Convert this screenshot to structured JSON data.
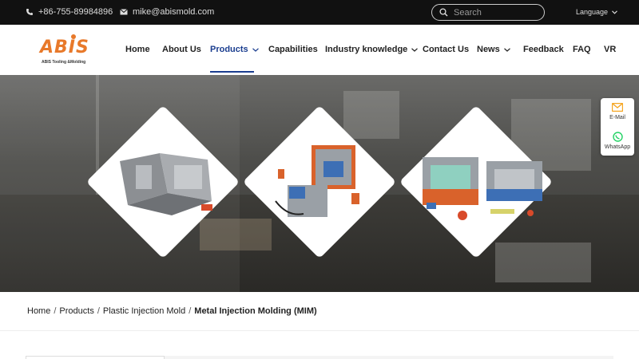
{
  "topbar": {
    "phone": "+86-755-89984896",
    "email": "mike@abismold.com",
    "search_placeholder": "Search",
    "language_label": "Language"
  },
  "logo": {
    "text": "ABIS",
    "subtitle": "ABIS Tooling &Molding"
  },
  "nav": {
    "items": [
      {
        "label": "Home"
      },
      {
        "label": "About Us"
      },
      {
        "label": "Products"
      },
      {
        "label": "Capabilities"
      },
      {
        "label": "Industry knowledge"
      },
      {
        "label": "Contact Us"
      },
      {
        "label": "News"
      },
      {
        "label": "Feedback"
      },
      {
        "label": "FAQ"
      },
      {
        "label": "VR"
      }
    ],
    "active": "Products"
  },
  "side_widget": {
    "email_label": "E-Mail",
    "whatsapp_label": "WhatsApp"
  },
  "breadcrumb": {
    "items": [
      "Home",
      "Products",
      "Plastic Injection Mold"
    ],
    "current": "Metal Injection Molding (MIM)"
  },
  "colors": {
    "accent": "#1a3d8f",
    "logo_orange": "#e8792a",
    "topbar_bg": "#111111",
    "email_icon": "#f5a623",
    "whatsapp_icon": "#25d366"
  }
}
